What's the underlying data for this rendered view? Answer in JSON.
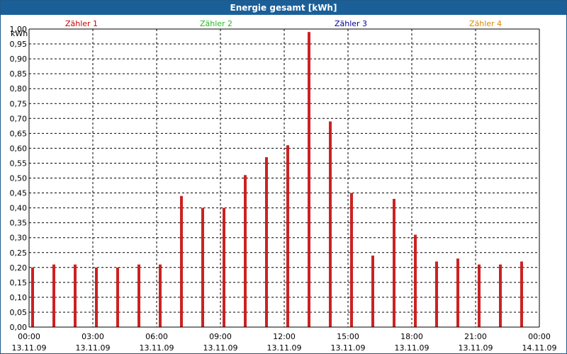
{
  "title": "Energie gesamt [kWh]",
  "legend": [
    {
      "label": "Zähler 1",
      "color": "#cc0000"
    },
    {
      "label": "Zähler 2",
      "color": "#22bb22"
    },
    {
      "label": "Zähler 3",
      "color": "#000099"
    },
    {
      "label": "Zähler 4",
      "color": "#dd8800"
    }
  ],
  "chart_data": {
    "type": "bar",
    "title": "Energie gesamt [kWh]",
    "ylabel": "kWh",
    "ylim": [
      0,
      1.0
    ],
    "yticks": [
      "0,00",
      "0,05",
      "0,10",
      "0,15",
      "0,20",
      "0,25",
      "0,30",
      "0,35",
      "0,40",
      "0,45",
      "0,50",
      "0,55",
      "0,60",
      "0,65",
      "0,70",
      "0,75",
      "0,80",
      "0,85",
      "0,90",
      "0,95",
      "1,00"
    ],
    "xlim_hours": [
      0,
      24
    ],
    "xticks": [
      {
        "time": "00:00",
        "date": "13.11.09"
      },
      {
        "time": "03:00",
        "date": "13.11.09"
      },
      {
        "time": "06:00",
        "date": "13.11.09"
      },
      {
        "time": "09:00",
        "date": "13.11.09"
      },
      {
        "time": "12:00",
        "date": "13.11.09"
      },
      {
        "time": "15:00",
        "date": "13.11.09"
      },
      {
        "time": "18:00",
        "date": "13.11.09"
      },
      {
        "time": "21:00",
        "date": "13.11.09"
      },
      {
        "time": "00:00",
        "date": "14.11.09"
      }
    ],
    "grid": true,
    "series": [
      {
        "name": "Zähler 1",
        "color": "#cc2222",
        "x_hours": [
          0,
          1,
          2,
          3,
          4,
          5,
          6,
          7,
          8,
          9,
          10,
          11,
          12,
          13,
          14,
          15,
          16,
          17,
          18,
          19,
          20,
          21,
          22,
          23
        ],
        "values": [
          0.2,
          0.21,
          0.21,
          0.2,
          0.2,
          0.21,
          0.21,
          0.44,
          0.4,
          0.4,
          0.51,
          0.57,
          0.61,
          0.99,
          0.69,
          0.45,
          0.24,
          0.43,
          0.31,
          0.22,
          0.23,
          0.21,
          0.21,
          0.22
        ]
      }
    ]
  }
}
